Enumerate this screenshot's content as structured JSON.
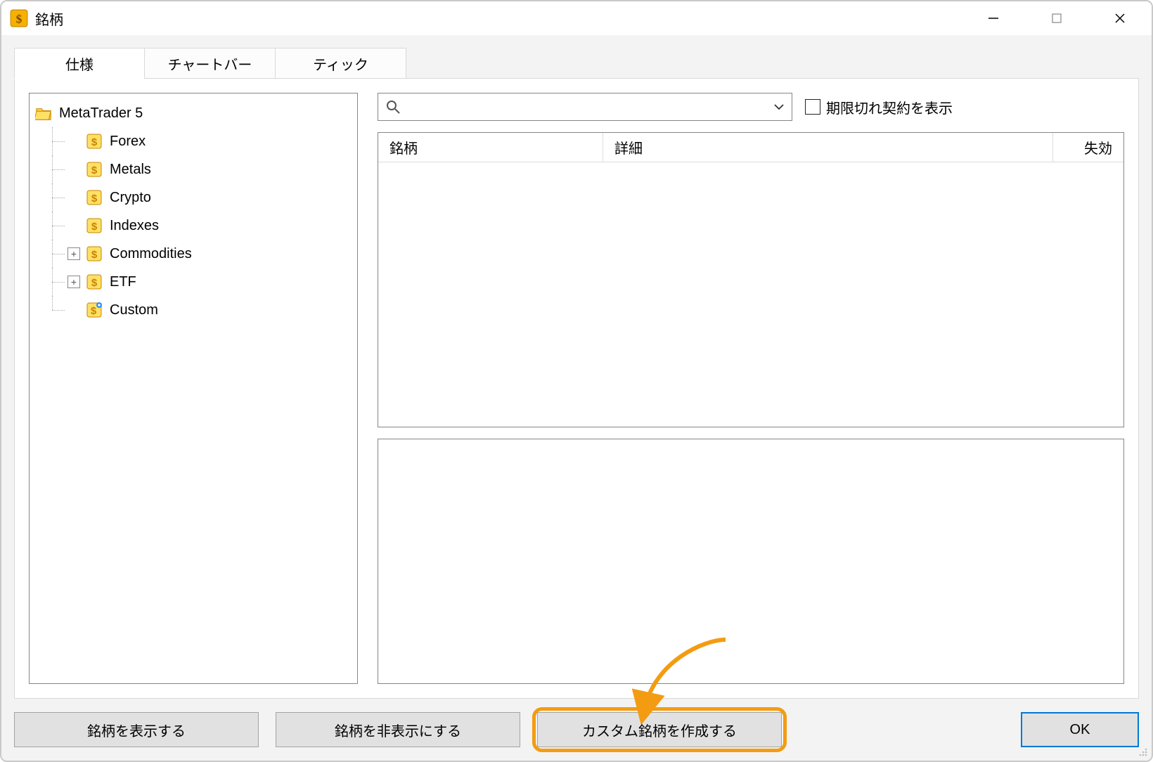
{
  "window": {
    "title": "銘柄"
  },
  "tabs": {
    "spec": "仕様",
    "chartbar": "チャートバー",
    "tick": "ティック"
  },
  "tree": {
    "root": "MetaTrader 5",
    "items": [
      {
        "label": "Forex",
        "type": "symbol",
        "expandable": false
      },
      {
        "label": "Metals",
        "type": "symbol",
        "expandable": false
      },
      {
        "label": "Crypto",
        "type": "symbol",
        "expandable": false
      },
      {
        "label": "Indexes",
        "type": "symbol",
        "expandable": false
      },
      {
        "label": "Commodities",
        "type": "symbol",
        "expandable": true
      },
      {
        "label": "ETF",
        "type": "symbol",
        "expandable": true
      },
      {
        "label": "Custom",
        "type": "custom",
        "expandable": false
      }
    ]
  },
  "search": {
    "value": "",
    "placeholder": ""
  },
  "checkbox": {
    "expired_label": "期限切れ契約を表示",
    "checked": false
  },
  "table": {
    "columns": {
      "symbol": "銘柄",
      "detail": "詳細",
      "disabled": "失効"
    },
    "rows": []
  },
  "buttons": {
    "show": "銘柄を表示する",
    "hide": "銘柄を非表示にする",
    "create_custom": "カスタム銘柄を作成する",
    "ok": "OK"
  },
  "annotation": {
    "highlight_target": "create_custom"
  }
}
